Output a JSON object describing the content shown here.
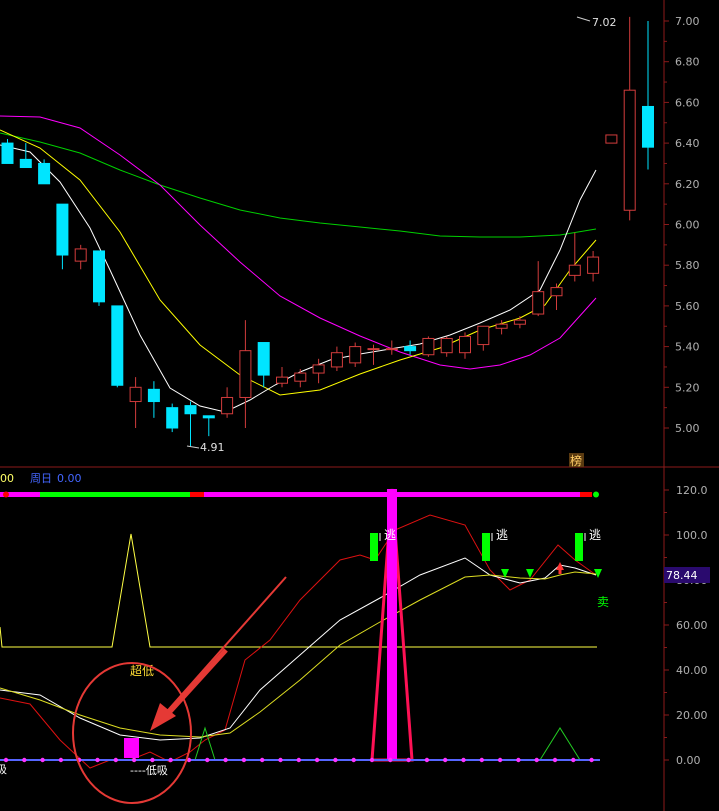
{
  "colors": {
    "background": "#000000",
    "axis_border": "#8b1a1a",
    "axis_text": "#b0b0b0",
    "candle_up": "#d23c3c",
    "candle_down": "#00e5ff",
    "ma_white": "#ffffff",
    "ma_yellow": "#ffff00",
    "ma_magenta": "#ff00ff",
    "ma_green": "#00d000",
    "indicator_red": "#ff0000",
    "signal_green": "#00ff00",
    "signal_magenta": "#ff00ff",
    "annotation": "#e53935"
  },
  "price_panel": {
    "y_axis_ticks": [
      "7.00",
      "6.80",
      "6.60",
      "6.40",
      "6.20",
      "6.00",
      "5.80",
      "5.60",
      "5.40",
      "5.20",
      "5.00"
    ],
    "high_label": "7.02",
    "low_label": "4.91",
    "badge": "榜"
  },
  "indicator_panel": {
    "header_left_value": "00",
    "header_label": "周日",
    "header_value": "0.00",
    "y_axis_ticks": [
      "120.0",
      "100.0",
      "80.00",
      "60.00",
      "40.00",
      "20.00",
      "0.00"
    ],
    "current_value_badge": "78.44",
    "signals": {
      "escape_label": "逃",
      "sell_label": "卖",
      "super_low_label": "超低",
      "low_buy_label": "----低吸",
      "left_edge_label": "吸"
    }
  },
  "chart_data": {
    "type": "candlestick",
    "ylim": [
      4.85,
      7.07
    ],
    "candles": [
      {
        "o": 6.4,
        "h": 6.42,
        "l": 6.3,
        "c": 6.3
      },
      {
        "o": 6.32,
        "h": 6.4,
        "l": 6.28,
        "c": 6.28
      },
      {
        "o": 6.3,
        "h": 6.32,
        "l": 6.2,
        "c": 6.2
      },
      {
        "o": 6.1,
        "h": 6.1,
        "l": 5.78,
        "c": 5.85
      },
      {
        "o": 5.82,
        "h": 5.9,
        "l": 5.78,
        "c": 5.88
      },
      {
        "o": 5.87,
        "h": 5.87,
        "l": 5.6,
        "c": 5.62
      },
      {
        "o": 5.6,
        "h": 5.6,
        "l": 5.2,
        "c": 5.21
      },
      {
        "o": 5.13,
        "h": 5.25,
        "l": 5.0,
        "c": 5.2
      },
      {
        "o": 5.19,
        "h": 5.23,
        "l": 5.05,
        "c": 5.13
      },
      {
        "o": 5.1,
        "h": 5.12,
        "l": 4.98,
        "c": 5.0
      },
      {
        "o": 5.11,
        "h": 5.13,
        "l": 4.91,
        "c": 5.07
      },
      {
        "o": 5.06,
        "h": 5.06,
        "l": 4.96,
        "c": 5.05
      },
      {
        "o": 5.07,
        "h": 5.2,
        "l": 5.05,
        "c": 5.15
      },
      {
        "o": 5.15,
        "h": 5.53,
        "l": 5.0,
        "c": 5.38
      },
      {
        "o": 5.42,
        "h": 5.42,
        "l": 5.2,
        "c": 5.26
      },
      {
        "o": 5.22,
        "h": 5.3,
        "l": 5.2,
        "c": 5.25
      },
      {
        "o": 5.23,
        "h": 5.29,
        "l": 5.2,
        "c": 5.27
      },
      {
        "o": 5.27,
        "h": 5.34,
        "l": 5.22,
        "c": 5.31
      },
      {
        "o": 5.3,
        "h": 5.4,
        "l": 5.28,
        "c": 5.37
      },
      {
        "o": 5.32,
        "h": 5.42,
        "l": 5.3,
        "c": 5.4
      },
      {
        "o": 5.39,
        "h": 5.41,
        "l": 5.31,
        "c": 5.39
      },
      {
        "o": 5.39,
        "h": 5.43,
        "l": 5.36,
        "c": 5.39
      },
      {
        "o": 5.4,
        "h": 5.43,
        "l": 5.36,
        "c": 5.38
      },
      {
        "o": 5.36,
        "h": 5.45,
        "l": 5.35,
        "c": 5.44
      },
      {
        "o": 5.37,
        "h": 5.45,
        "l": 5.35,
        "c": 5.44
      },
      {
        "o": 5.37,
        "h": 5.47,
        "l": 5.34,
        "c": 5.45
      },
      {
        "o": 5.41,
        "h": 5.5,
        "l": 5.38,
        "c": 5.5
      },
      {
        "o": 5.49,
        "h": 5.53,
        "l": 5.46,
        "c": 5.51
      },
      {
        "o": 5.51,
        "h": 5.55,
        "l": 5.49,
        "c": 5.53
      },
      {
        "o": 5.56,
        "h": 5.82,
        "l": 5.55,
        "c": 5.67
      },
      {
        "o": 5.65,
        "h": 5.71,
        "l": 5.58,
        "c": 5.69
      },
      {
        "o": 5.75,
        "h": 5.96,
        "l": 5.72,
        "c": 5.8
      },
      {
        "o": 5.76,
        "h": 5.87,
        "l": 5.72,
        "c": 5.84
      },
      {
        "o": 6.4,
        "h": 6.44,
        "l": 6.4,
        "c": 6.44
      },
      {
        "o": 6.07,
        "h": 7.02,
        "l": 6.02,
        "c": 6.66
      },
      {
        "o": 6.58,
        "h": 7.0,
        "l": 6.27,
        "c": 6.38
      }
    ]
  }
}
